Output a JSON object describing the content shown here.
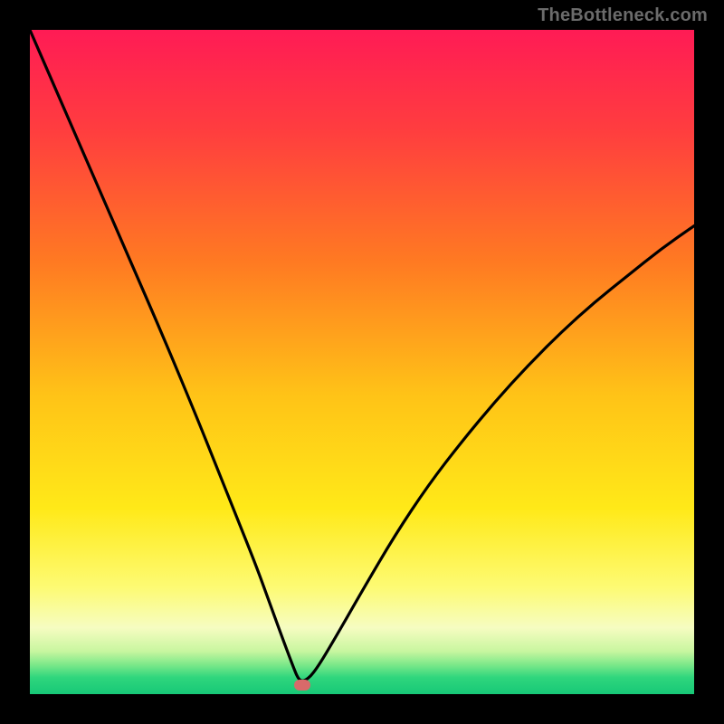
{
  "watermark_text": "TheBottleneck.com",
  "colors": {
    "page_bg": "#000000",
    "curve": "#000000",
    "marker": "#d86a6a",
    "watermark": "#6b6b6b",
    "gradient_stops": [
      {
        "offset": 0.0,
        "color": "#ff1b55"
      },
      {
        "offset": 0.15,
        "color": "#ff3d3f"
      },
      {
        "offset": 0.35,
        "color": "#ff7a22"
      },
      {
        "offset": 0.55,
        "color": "#ffc317"
      },
      {
        "offset": 0.72,
        "color": "#ffe918"
      },
      {
        "offset": 0.84,
        "color": "#fdfb74"
      },
      {
        "offset": 0.9,
        "color": "#f6fcc1"
      },
      {
        "offset": 0.935,
        "color": "#c9f6a0"
      },
      {
        "offset": 0.955,
        "color": "#7fe98a"
      },
      {
        "offset": 0.975,
        "color": "#2fd67d"
      },
      {
        "offset": 1.0,
        "color": "#17c877"
      }
    ]
  },
  "chart_data": {
    "type": "line",
    "title": "",
    "xlabel": "",
    "ylabel": "",
    "xlim": [
      0,
      100
    ],
    "ylim": [
      0,
      100
    ],
    "grid": false,
    "legend": false,
    "annotations": [],
    "marker": {
      "x": 41,
      "y": 1.3
    },
    "series": [
      {
        "name": "bottleneck-curve",
        "x": [
          0,
          5,
          10,
          15,
          20,
          25,
          28,
          31,
          34,
          36,
          38,
          39.5,
          40.5,
          41.5,
          43,
          46,
          50,
          55,
          60,
          65,
          70,
          75,
          80,
          85,
          90,
          95,
          100
        ],
        "y": [
          100,
          88.5,
          77,
          65.5,
          54,
          42,
          34.5,
          27,
          19.5,
          14,
          8.5,
          4.5,
          2,
          2,
          3.5,
          8.5,
          15.5,
          24,
          31.5,
          38,
          44,
          49.5,
          54.5,
          59,
          63,
          67,
          70.5
        ]
      }
    ]
  }
}
